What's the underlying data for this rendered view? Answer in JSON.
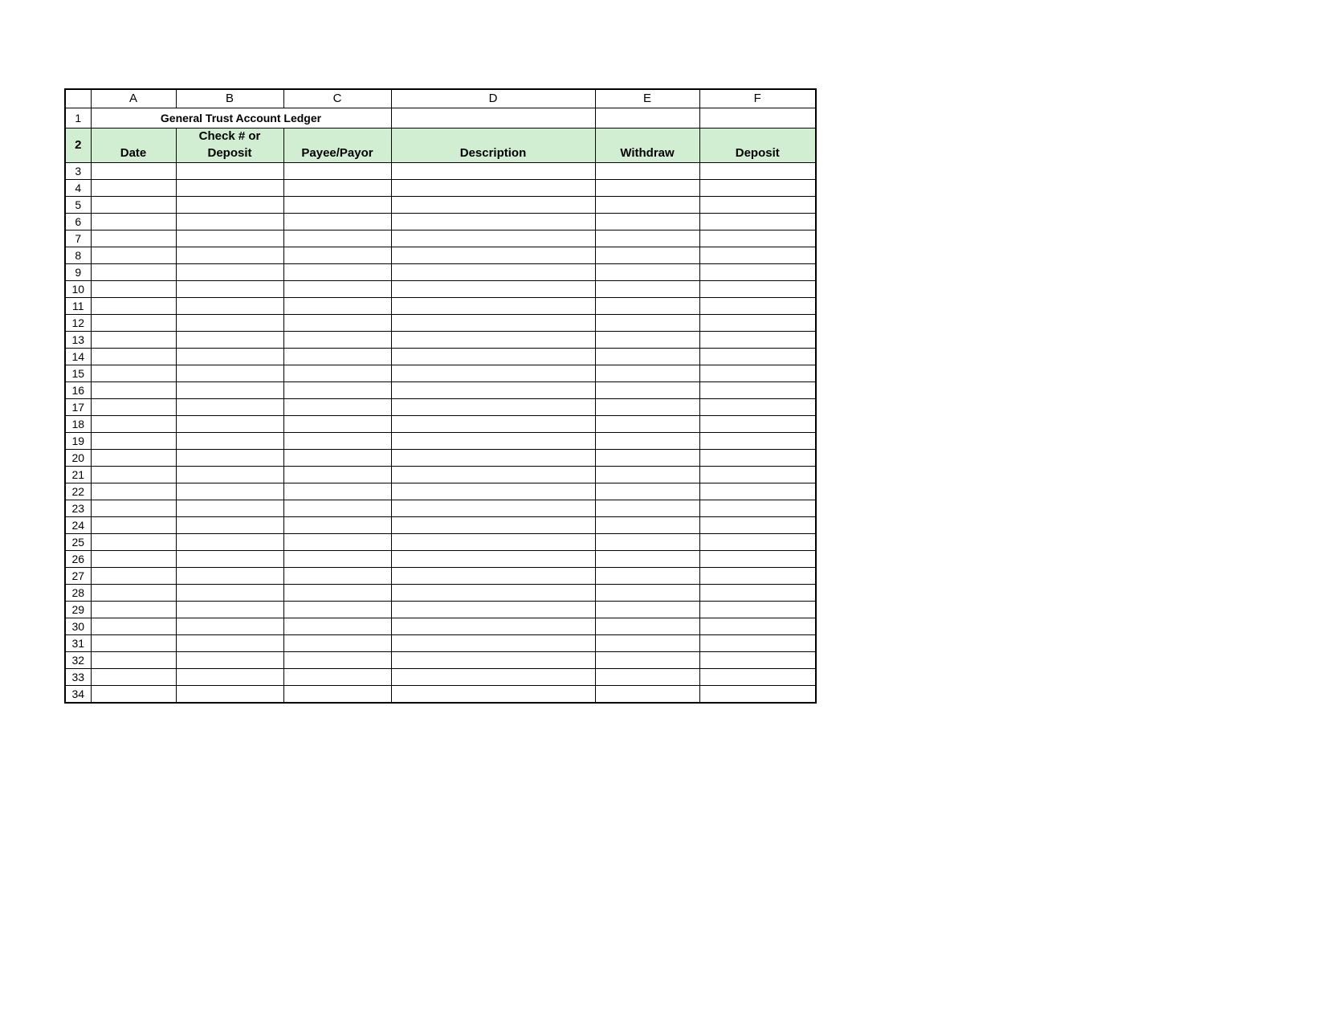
{
  "columns": [
    "A",
    "B",
    "C",
    "D",
    "E",
    "F"
  ],
  "title": "General Trust Account Ledger",
  "headers": {
    "A_top": "",
    "A_bottom": "Date",
    "B_top": "Check # or",
    "B_bottom": "Deposit",
    "C_top": "",
    "C_bottom": "Payee/Payor",
    "D_top": "",
    "D_bottom": "Description",
    "E_top": "",
    "E_bottom": "Withdraw",
    "F_top": "",
    "F_bottom": "Deposit"
  },
  "row_numbers": [
    1,
    2,
    3,
    4,
    5,
    6,
    7,
    8,
    9,
    10,
    11,
    12,
    13,
    14,
    15,
    16,
    17,
    18,
    19,
    20,
    21,
    22,
    23,
    24,
    25,
    26,
    27,
    28,
    29,
    30,
    31,
    32,
    33,
    34
  ],
  "rows": [
    {
      "A": "",
      "B": "",
      "C": "",
      "D": "",
      "E": "",
      "F": ""
    },
    {
      "A": "",
      "B": "",
      "C": "",
      "D": "",
      "E": "",
      "F": ""
    },
    {
      "A": "",
      "B": "",
      "C": "",
      "D": "",
      "E": "",
      "F": ""
    },
    {
      "A": "",
      "B": "",
      "C": "",
      "D": "",
      "E": "",
      "F": ""
    },
    {
      "A": "",
      "B": "",
      "C": "",
      "D": "",
      "E": "",
      "F": ""
    },
    {
      "A": "",
      "B": "",
      "C": "",
      "D": "",
      "E": "",
      "F": ""
    },
    {
      "A": "",
      "B": "",
      "C": "",
      "D": "",
      "E": "",
      "F": ""
    },
    {
      "A": "",
      "B": "",
      "C": "",
      "D": "",
      "E": "",
      "F": ""
    },
    {
      "A": "",
      "B": "",
      "C": "",
      "D": "",
      "E": "",
      "F": ""
    },
    {
      "A": "",
      "B": "",
      "C": "",
      "D": "",
      "E": "",
      "F": ""
    },
    {
      "A": "",
      "B": "",
      "C": "",
      "D": "",
      "E": "",
      "F": ""
    },
    {
      "A": "",
      "B": "",
      "C": "",
      "D": "",
      "E": "",
      "F": ""
    },
    {
      "A": "",
      "B": "",
      "C": "",
      "D": "",
      "E": "",
      "F": ""
    },
    {
      "A": "",
      "B": "",
      "C": "",
      "D": "",
      "E": "",
      "F": ""
    },
    {
      "A": "",
      "B": "",
      "C": "",
      "D": "",
      "E": "",
      "F": ""
    },
    {
      "A": "",
      "B": "",
      "C": "",
      "D": "",
      "E": "",
      "F": ""
    },
    {
      "A": "",
      "B": "",
      "C": "",
      "D": "",
      "E": "",
      "F": ""
    },
    {
      "A": "",
      "B": "",
      "C": "",
      "D": "",
      "E": "",
      "F": ""
    },
    {
      "A": "",
      "B": "",
      "C": "",
      "D": "",
      "E": "",
      "F": ""
    },
    {
      "A": "",
      "B": "",
      "C": "",
      "D": "",
      "E": "",
      "F": ""
    },
    {
      "A": "",
      "B": "",
      "C": "",
      "D": "",
      "E": "",
      "F": ""
    },
    {
      "A": "",
      "B": "",
      "C": "",
      "D": "",
      "E": "",
      "F": ""
    },
    {
      "A": "",
      "B": "",
      "C": "",
      "D": "",
      "E": "",
      "F": ""
    },
    {
      "A": "",
      "B": "",
      "C": "",
      "D": "",
      "E": "",
      "F": ""
    },
    {
      "A": "",
      "B": "",
      "C": "",
      "D": "",
      "E": "",
      "F": ""
    },
    {
      "A": "",
      "B": "",
      "C": "",
      "D": "",
      "E": "",
      "F": ""
    },
    {
      "A": "",
      "B": "",
      "C": "",
      "D": "",
      "E": "",
      "F": ""
    },
    {
      "A": "",
      "B": "",
      "C": "",
      "D": "",
      "E": "",
      "F": ""
    },
    {
      "A": "",
      "B": "",
      "C": "",
      "D": "",
      "E": "",
      "F": ""
    },
    {
      "A": "",
      "B": "",
      "C": "",
      "D": "",
      "E": "",
      "F": ""
    },
    {
      "A": "",
      "B": "",
      "C": "",
      "D": "",
      "E": "",
      "F": ""
    },
    {
      "A": "",
      "B": "",
      "C": "",
      "D": "",
      "E": "",
      "F": ""
    }
  ]
}
